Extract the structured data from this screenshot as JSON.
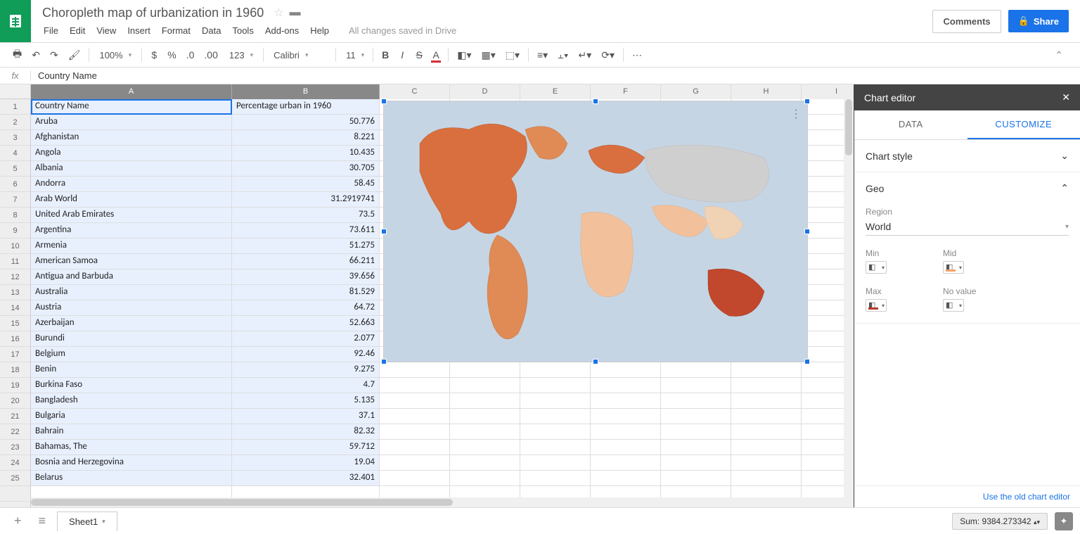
{
  "doc_title": "Choropleth map of urbanization in 1960",
  "menus": [
    "File",
    "Edit",
    "View",
    "Insert",
    "Format",
    "Data",
    "Tools",
    "Add-ons",
    "Help"
  ],
  "save_status": "All changes saved in Drive",
  "comments_label": "Comments",
  "share_label": "Share",
  "toolbar": {
    "zoom": "100%",
    "font": "Calibri",
    "size": "11"
  },
  "formula_bar": {
    "fx": "fx",
    "value": "Country Name"
  },
  "columns": [
    "A",
    "B",
    "C",
    "D",
    "E",
    "F",
    "G",
    "H",
    "I"
  ],
  "rows": [
    {
      "n": 1,
      "a": "Country Name",
      "b": "Percentage urban in 1960"
    },
    {
      "n": 2,
      "a": "Aruba",
      "b": "50.776"
    },
    {
      "n": 3,
      "a": "Afghanistan",
      "b": "8.221"
    },
    {
      "n": 4,
      "a": "Angola",
      "b": "10.435"
    },
    {
      "n": 5,
      "a": "Albania",
      "b": "30.705"
    },
    {
      "n": 6,
      "a": "Andorra",
      "b": "58.45"
    },
    {
      "n": 7,
      "a": "Arab World",
      "b": "31.2919741"
    },
    {
      "n": 8,
      "a": "United Arab Emirates",
      "b": "73.5"
    },
    {
      "n": 9,
      "a": "Argentina",
      "b": "73.611"
    },
    {
      "n": 10,
      "a": "Armenia",
      "b": "51.275"
    },
    {
      "n": 11,
      "a": "American Samoa",
      "b": "66.211"
    },
    {
      "n": 12,
      "a": "Antigua and Barbuda",
      "b": "39.656"
    },
    {
      "n": 13,
      "a": "Australia",
      "b": "81.529"
    },
    {
      "n": 14,
      "a": "Austria",
      "b": "64.72"
    },
    {
      "n": 15,
      "a": "Azerbaijan",
      "b": "52.663"
    },
    {
      "n": 16,
      "a": "Burundi",
      "b": "2.077"
    },
    {
      "n": 17,
      "a": "Belgium",
      "b": "92.46"
    },
    {
      "n": 18,
      "a": "Benin",
      "b": "9.275"
    },
    {
      "n": 19,
      "a": "Burkina Faso",
      "b": "4.7"
    },
    {
      "n": 20,
      "a": "Bangladesh",
      "b": "5.135"
    },
    {
      "n": 21,
      "a": "Bulgaria",
      "b": "37.1"
    },
    {
      "n": 22,
      "a": "Bahrain",
      "b": "82.32"
    },
    {
      "n": 23,
      "a": "Bahamas, The",
      "b": "59.712"
    },
    {
      "n": 24,
      "a": "Bosnia and Herzegovina",
      "b": "19.04"
    },
    {
      "n": 25,
      "a": "Belarus",
      "b": "32.401"
    }
  ],
  "sidebar": {
    "title": "Chart editor",
    "tab_data": "DATA",
    "tab_customize": "CUSTOMIZE",
    "chart_style": "Chart style",
    "geo": "Geo",
    "region_label": "Region",
    "region_value": "World",
    "min": "Min",
    "mid": "Mid",
    "max": "Max",
    "novalue": "No value",
    "footer": "Use the old chart editor"
  },
  "sheet_tab": "Sheet1",
  "sum": "Sum: 9384.273342",
  "chart_data": {
    "type": "geo-choropleth",
    "title": "",
    "region": "World",
    "value_label": "Percentage urban in 1960",
    "color_scale": {
      "min": "#fde0c5",
      "mid": "#f5a26b",
      "max": "#b63a29",
      "no_value": "#cccccc"
    },
    "data": [
      {
        "country": "Aruba",
        "value": 50.776
      },
      {
        "country": "Afghanistan",
        "value": 8.221
      },
      {
        "country": "Angola",
        "value": 10.435
      },
      {
        "country": "Albania",
        "value": 30.705
      },
      {
        "country": "Andorra",
        "value": 58.45
      },
      {
        "country": "Arab World",
        "value": 31.2919741
      },
      {
        "country": "United Arab Emirates",
        "value": 73.5
      },
      {
        "country": "Argentina",
        "value": 73.611
      },
      {
        "country": "Armenia",
        "value": 51.275
      },
      {
        "country": "American Samoa",
        "value": 66.211
      },
      {
        "country": "Antigua and Barbuda",
        "value": 39.656
      },
      {
        "country": "Australia",
        "value": 81.529
      },
      {
        "country": "Austria",
        "value": 64.72
      },
      {
        "country": "Azerbaijan",
        "value": 52.663
      },
      {
        "country": "Burundi",
        "value": 2.077
      },
      {
        "country": "Belgium",
        "value": 92.46
      },
      {
        "country": "Benin",
        "value": 9.275
      },
      {
        "country": "Burkina Faso",
        "value": 4.7
      },
      {
        "country": "Bangladesh",
        "value": 5.135
      },
      {
        "country": "Bulgaria",
        "value": 37.1
      },
      {
        "country": "Bahrain",
        "value": 82.32
      },
      {
        "country": "Bahamas, The",
        "value": 59.712
      },
      {
        "country": "Bosnia and Herzegovina",
        "value": 19.04
      },
      {
        "country": "Belarus",
        "value": 32.401
      }
    ]
  }
}
